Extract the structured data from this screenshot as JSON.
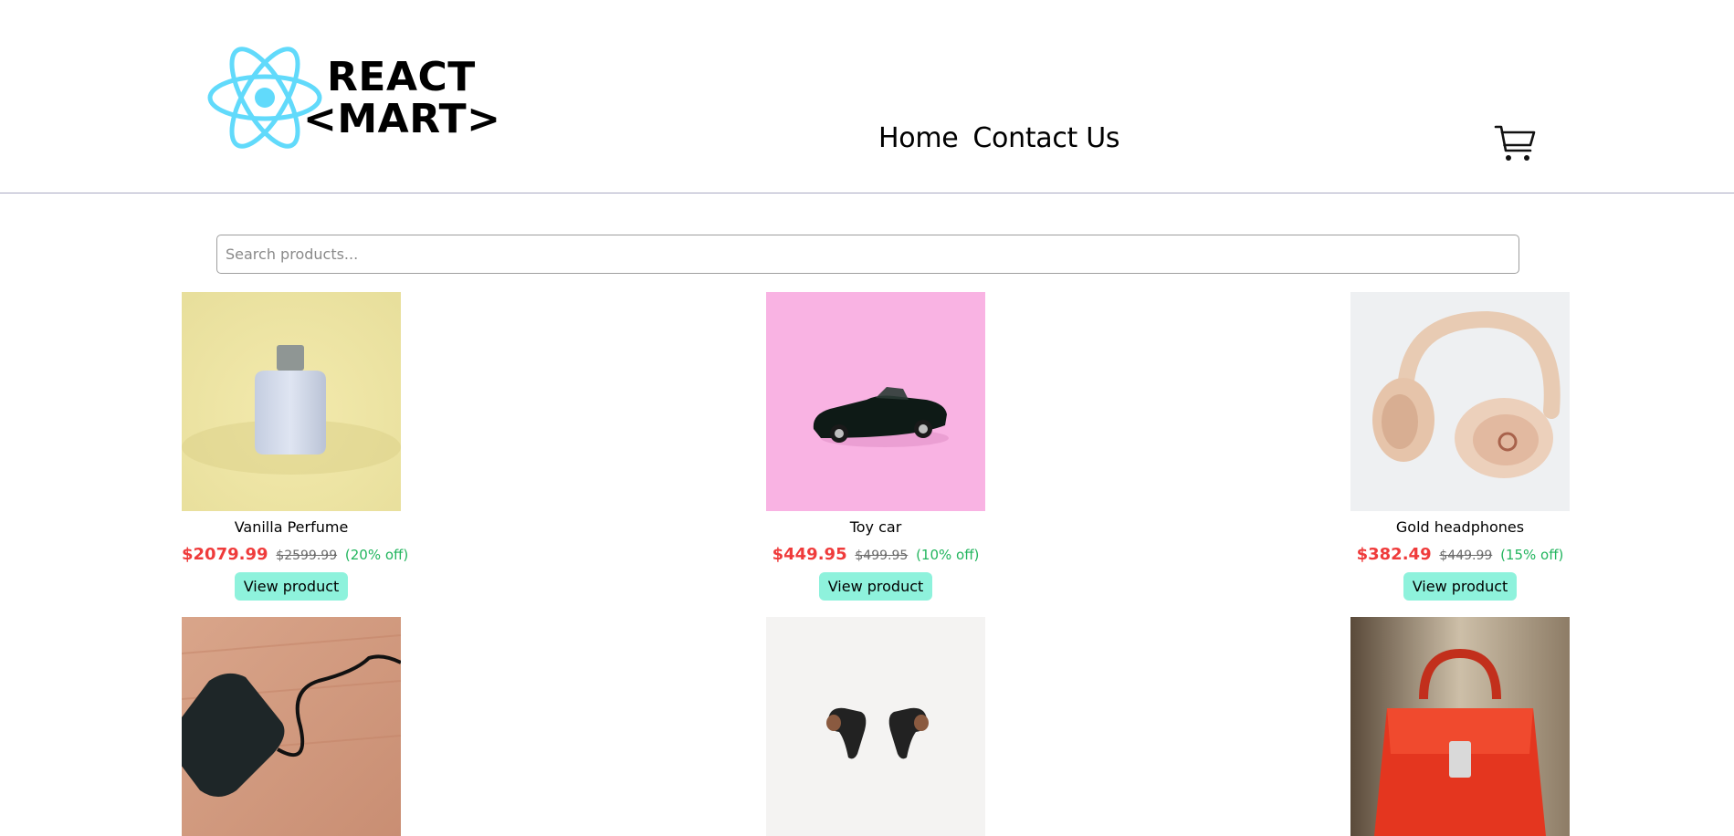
{
  "brand": {
    "line1": "REACT",
    "line2": "<MART>",
    "logo_icon": "react-atom-icon",
    "logo_color": "#61dafb"
  },
  "nav": {
    "items": [
      {
        "label": "Home"
      },
      {
        "label": "Contact Us"
      }
    ]
  },
  "cart": {
    "icon": "cart-icon"
  },
  "search": {
    "placeholder": "Search products...",
    "value": ""
  },
  "colors": {
    "price": "#ef3b3b",
    "discount": "#22b55e",
    "button": "#8ef2dc",
    "divider": "#a9a9c2"
  },
  "products": [
    {
      "name": "Vanilla Perfume",
      "price": "$2079.99",
      "original_price": "$2599.99",
      "discount": "(20% off)",
      "button": "View product",
      "image": "perfume-image"
    },
    {
      "name": "Toy car",
      "price": "$449.95",
      "original_price": "$499.95",
      "discount": "(10% off)",
      "button": "View product",
      "image": "toy-car-image"
    },
    {
      "name": "Gold headphones",
      "price": "$382.49",
      "original_price": "$449.99",
      "discount": "(15% off)",
      "button": "View product",
      "image": "headphones-image"
    },
    {
      "name": "",
      "image": "power-bank-image"
    },
    {
      "name": "",
      "image": "earbuds-image"
    },
    {
      "name": "",
      "image": "red-handbag-image"
    }
  ]
}
